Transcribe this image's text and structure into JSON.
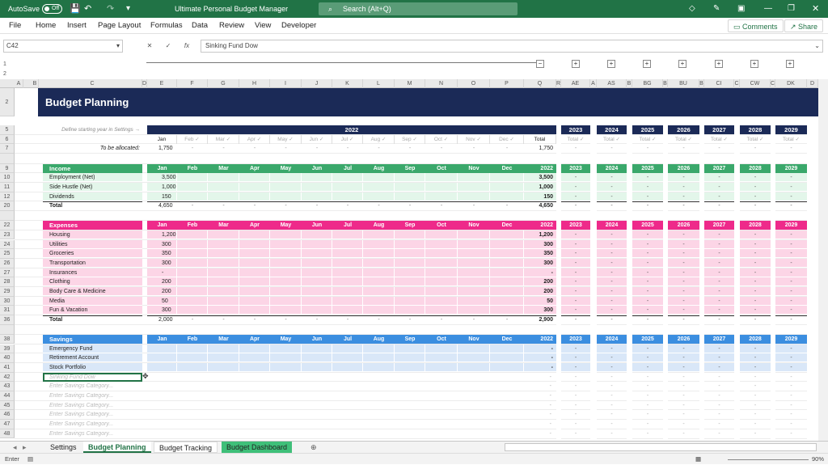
{
  "window": {
    "title": "Ultimate Personal Budget Manager",
    "autosave": "AutoSave",
    "autosave_state": "Off",
    "search": "Search (Alt+Q)"
  },
  "menu": {
    "items": [
      "File",
      "Home",
      "Insert",
      "Page Layout",
      "Formulas",
      "Data",
      "Review",
      "View",
      "Developer"
    ],
    "comments": "Comments",
    "share": "Share"
  },
  "formula": {
    "cell": "C42",
    "content": "Sinking Fund Dow"
  },
  "columns": [
    "A",
    "B",
    "C",
    "D",
    "E",
    "F",
    "G",
    "H",
    "I",
    "J",
    "K",
    "L",
    "M",
    "N",
    "O",
    "P",
    "Q",
    "R",
    "AE",
    "A",
    "AS",
    "B",
    "BG",
    "B",
    "BU",
    "B",
    "CI",
    "C",
    "CW",
    "C",
    "DK",
    "D"
  ],
  "sheet": {
    "title": "Budget Planning",
    "hint": "Define starting year in Settings →",
    "allocated_label": "To be allocated:",
    "months": [
      "Jan",
      "Feb",
      "Mar",
      "Apr",
      "May",
      "Jun",
      "Jul",
      "Aug",
      "Sep",
      "Oct",
      "Nov",
      "Dec"
    ],
    "year": "2022",
    "years": [
      "2023",
      "2024",
      "2025",
      "2026",
      "2027",
      "2028",
      "2029"
    ],
    "month_row": [
      "Jan",
      "Feb ✓",
      "Mar ✓",
      "Apr ✓",
      "May ✓",
      "Jun ✓",
      "Jul ✓",
      "Aug ✓",
      "Sep ✓",
      "Oct ✓",
      "Nov ✓",
      "Dec ✓",
      "Total"
    ],
    "year_total_label": "Total ✓",
    "allocated_jan": "1,750",
    "allocated_total": "1,750",
    "income": {
      "label": "Income",
      "rows": [
        {
          "r": "10",
          "name": "Employment (Net)",
          "jan": "3,500",
          "total": "3,500"
        },
        {
          "r": "11",
          "name": "Side Hustle (Net)",
          "jan": "1,000",
          "total": "1,000"
        },
        {
          "r": "12",
          "name": "Dividends",
          "jan": "150",
          "total": "150"
        }
      ],
      "total_row": {
        "r": "20",
        "name": "Total",
        "jan": "4,650",
        "total": "4,650"
      }
    },
    "expenses": {
      "label": "Expenses",
      "rows": [
        {
          "r": "23",
          "name": "Housing",
          "jan": "1,200",
          "total": "1,200"
        },
        {
          "r": "24",
          "name": "Utilities",
          "jan": "300",
          "total": "300"
        },
        {
          "r": "25",
          "name": "Groceries",
          "jan": "350",
          "total": "350"
        },
        {
          "r": "26",
          "name": "Transportation",
          "jan": "300",
          "total": "300"
        },
        {
          "r": "27",
          "name": "Insurances",
          "jan": "-",
          "total": "-"
        },
        {
          "r": "28",
          "name": "Clothing",
          "jan": "200",
          "total": "200"
        },
        {
          "r": "29",
          "name": "Body Care & Medicine",
          "jan": "200",
          "total": "200"
        },
        {
          "r": "30",
          "name": "Media",
          "jan": "50",
          "total": "50"
        },
        {
          "r": "31",
          "name": "Fun & Vacation",
          "jan": "300",
          "total": "300"
        }
      ],
      "total_row": {
        "r": "36",
        "name": "Total",
        "jan": "2,000",
        "total": "2,900"
      }
    },
    "savings": {
      "label": "Savings",
      "rows": [
        {
          "r": "39",
          "name": "Emergency Fund",
          "jan": "",
          "total": "-"
        },
        {
          "r": "40",
          "name": "Retirement Account",
          "jan": "",
          "total": "-"
        },
        {
          "r": "41",
          "name": "Stock Portfolio",
          "jan": "",
          "total": "-"
        }
      ],
      "placeholder_rows": [
        {
          "r": "42",
          "name": "Sinking Fund Dow"
        },
        {
          "r": "43",
          "name": "Enter Savings Category..."
        },
        {
          "r": "44",
          "name": "Enter Savings Category..."
        },
        {
          "r": "45",
          "name": "Enter Savings Category..."
        },
        {
          "r": "46",
          "name": "Enter Savings Category..."
        },
        {
          "r": "47",
          "name": "Enter Savings Category..."
        },
        {
          "r": "48",
          "name": "Enter Savings Category..."
        }
      ]
    },
    "dash": "-"
  },
  "tabs": [
    "Settings",
    "Budget Planning",
    "Budget Tracking",
    "Budget Dashboard"
  ],
  "status": {
    "mode": "Enter",
    "zoom": "90%"
  },
  "colors": {
    "green": "#217346",
    "navy": "#1b2a57",
    "income": "#3aa86b",
    "income_light": "#e3f6ea",
    "expense": "#ee2a8a",
    "expense_light": "#fcd5e6",
    "savings": "#3b8ee0",
    "savings_light": "#d9e7f8"
  }
}
